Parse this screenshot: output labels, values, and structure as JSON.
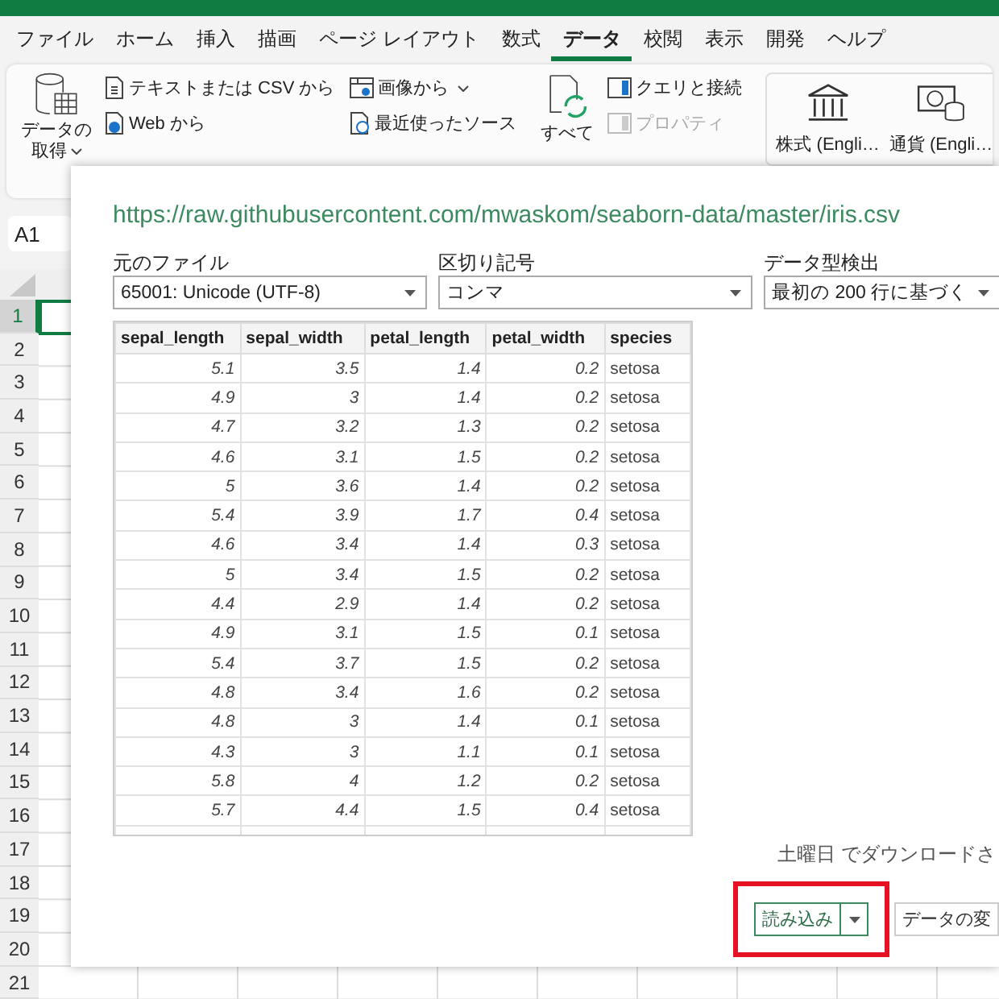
{
  "menu_tabs": [
    {
      "label": "ファイル",
      "selected": false
    },
    {
      "label": "ホーム",
      "selected": false
    },
    {
      "label": "挿入",
      "selected": false
    },
    {
      "label": "描画",
      "selected": false
    },
    {
      "label": "ページ レイアウト",
      "selected": false
    },
    {
      "label": "数式",
      "selected": false
    },
    {
      "label": "データ",
      "selected": true
    },
    {
      "label": "校閲",
      "selected": false
    },
    {
      "label": "表示",
      "selected": false
    },
    {
      "label": "開発",
      "selected": false
    },
    {
      "label": "ヘルプ",
      "selected": false
    }
  ],
  "ribbon": {
    "get_data": {
      "lines": [
        "データの",
        "取得"
      ]
    },
    "source_items": [
      {
        "label": "テキストまたは CSV から",
        "kind": "text-file"
      },
      {
        "label": "Web から",
        "kind": "web"
      }
    ],
    "recent_items": [
      {
        "label": "画像から",
        "kind": "image",
        "dropdown": true
      },
      {
        "label": "最近使ったソース",
        "kind": "recent",
        "dropdown": false
      }
    ],
    "refresh": {
      "lines": [
        "すべて"
      ]
    },
    "query_items": [
      {
        "label": "クエリと接続",
        "disabled": false
      },
      {
        "label": "プロパティ",
        "disabled": true
      }
    ],
    "data_types": [
      {
        "label": "株式 (Engli…",
        "kind": "bank"
      },
      {
        "label": "通貨 (Engli…",
        "kind": "currency"
      }
    ]
  },
  "name_box": "A1",
  "rows": [
    {
      "label": "1",
      "selected": true
    },
    {
      "label": "2",
      "selected": false
    },
    {
      "label": "3",
      "selected": false
    },
    {
      "label": "4",
      "selected": false
    },
    {
      "label": "5",
      "selected": false
    },
    {
      "label": "6",
      "selected": false
    },
    {
      "label": "7",
      "selected": false
    },
    {
      "label": "8",
      "selected": false
    },
    {
      "label": "9",
      "selected": false
    },
    {
      "label": "10",
      "selected": false
    },
    {
      "label": "11",
      "selected": false
    },
    {
      "label": "12",
      "selected": false
    },
    {
      "label": "13",
      "selected": false
    },
    {
      "label": "14",
      "selected": false
    },
    {
      "label": "15",
      "selected": false
    },
    {
      "label": "16",
      "selected": false
    },
    {
      "label": "17",
      "selected": false
    },
    {
      "label": "18",
      "selected": false
    },
    {
      "label": "19",
      "selected": false
    },
    {
      "label": "20",
      "selected": false
    },
    {
      "label": "21",
      "selected": false
    }
  ],
  "dialog": {
    "title": "https://raw.githubusercontent.com/mwaskom/seaborn-data/master/iris.csv",
    "fields": [
      {
        "label": "元のファイル",
        "value": "65001: Unicode (UTF-8)"
      },
      {
        "label": "区切り記号",
        "value": "コンマ"
      },
      {
        "label": "データ型検出",
        "value": "最初の 200 行に基づく"
      }
    ],
    "table": {
      "columns": [
        {
          "label": "sepal_length",
          "kind": "number"
        },
        {
          "label": "sepal_width",
          "kind": "number"
        },
        {
          "label": "petal_length",
          "kind": "number"
        },
        {
          "label": "petal_width",
          "kind": "number"
        },
        {
          "label": "species",
          "kind": "text"
        }
      ],
      "rows": [
        [
          "5.1",
          "3.5",
          "1.4",
          "0.2",
          "setosa"
        ],
        [
          "4.9",
          "3",
          "1.4",
          "0.2",
          "setosa"
        ],
        [
          "4.7",
          "3.2",
          "1.3",
          "0.2",
          "setosa"
        ],
        [
          "4.6",
          "3.1",
          "1.5",
          "0.2",
          "setosa"
        ],
        [
          "5",
          "3.6",
          "1.4",
          "0.2",
          "setosa"
        ],
        [
          "5.4",
          "3.9",
          "1.7",
          "0.4",
          "setosa"
        ],
        [
          "4.6",
          "3.4",
          "1.4",
          "0.3",
          "setosa"
        ],
        [
          "5",
          "3.4",
          "1.5",
          "0.2",
          "setosa"
        ],
        [
          "4.4",
          "2.9",
          "1.4",
          "0.2",
          "setosa"
        ],
        [
          "4.9",
          "3.1",
          "1.5",
          "0.1",
          "setosa"
        ],
        [
          "5.4",
          "3.7",
          "1.5",
          "0.2",
          "setosa"
        ],
        [
          "4.8",
          "3.4",
          "1.6",
          "0.2",
          "setosa"
        ],
        [
          "4.8",
          "3",
          "1.4",
          "0.1",
          "setosa"
        ],
        [
          "4.3",
          "3",
          "1.1",
          "0.1",
          "setosa"
        ],
        [
          "5.8",
          "4",
          "1.2",
          "0.2",
          "setosa"
        ],
        [
          "5.7",
          "4.4",
          "1.5",
          "0.4",
          "setosa"
        ]
      ]
    },
    "status": "土曜日 でダウンロードさ",
    "load_button": {
      "label": "読み込み",
      "highlighted": true
    },
    "transform_button": {
      "label": "データの変"
    }
  }
}
